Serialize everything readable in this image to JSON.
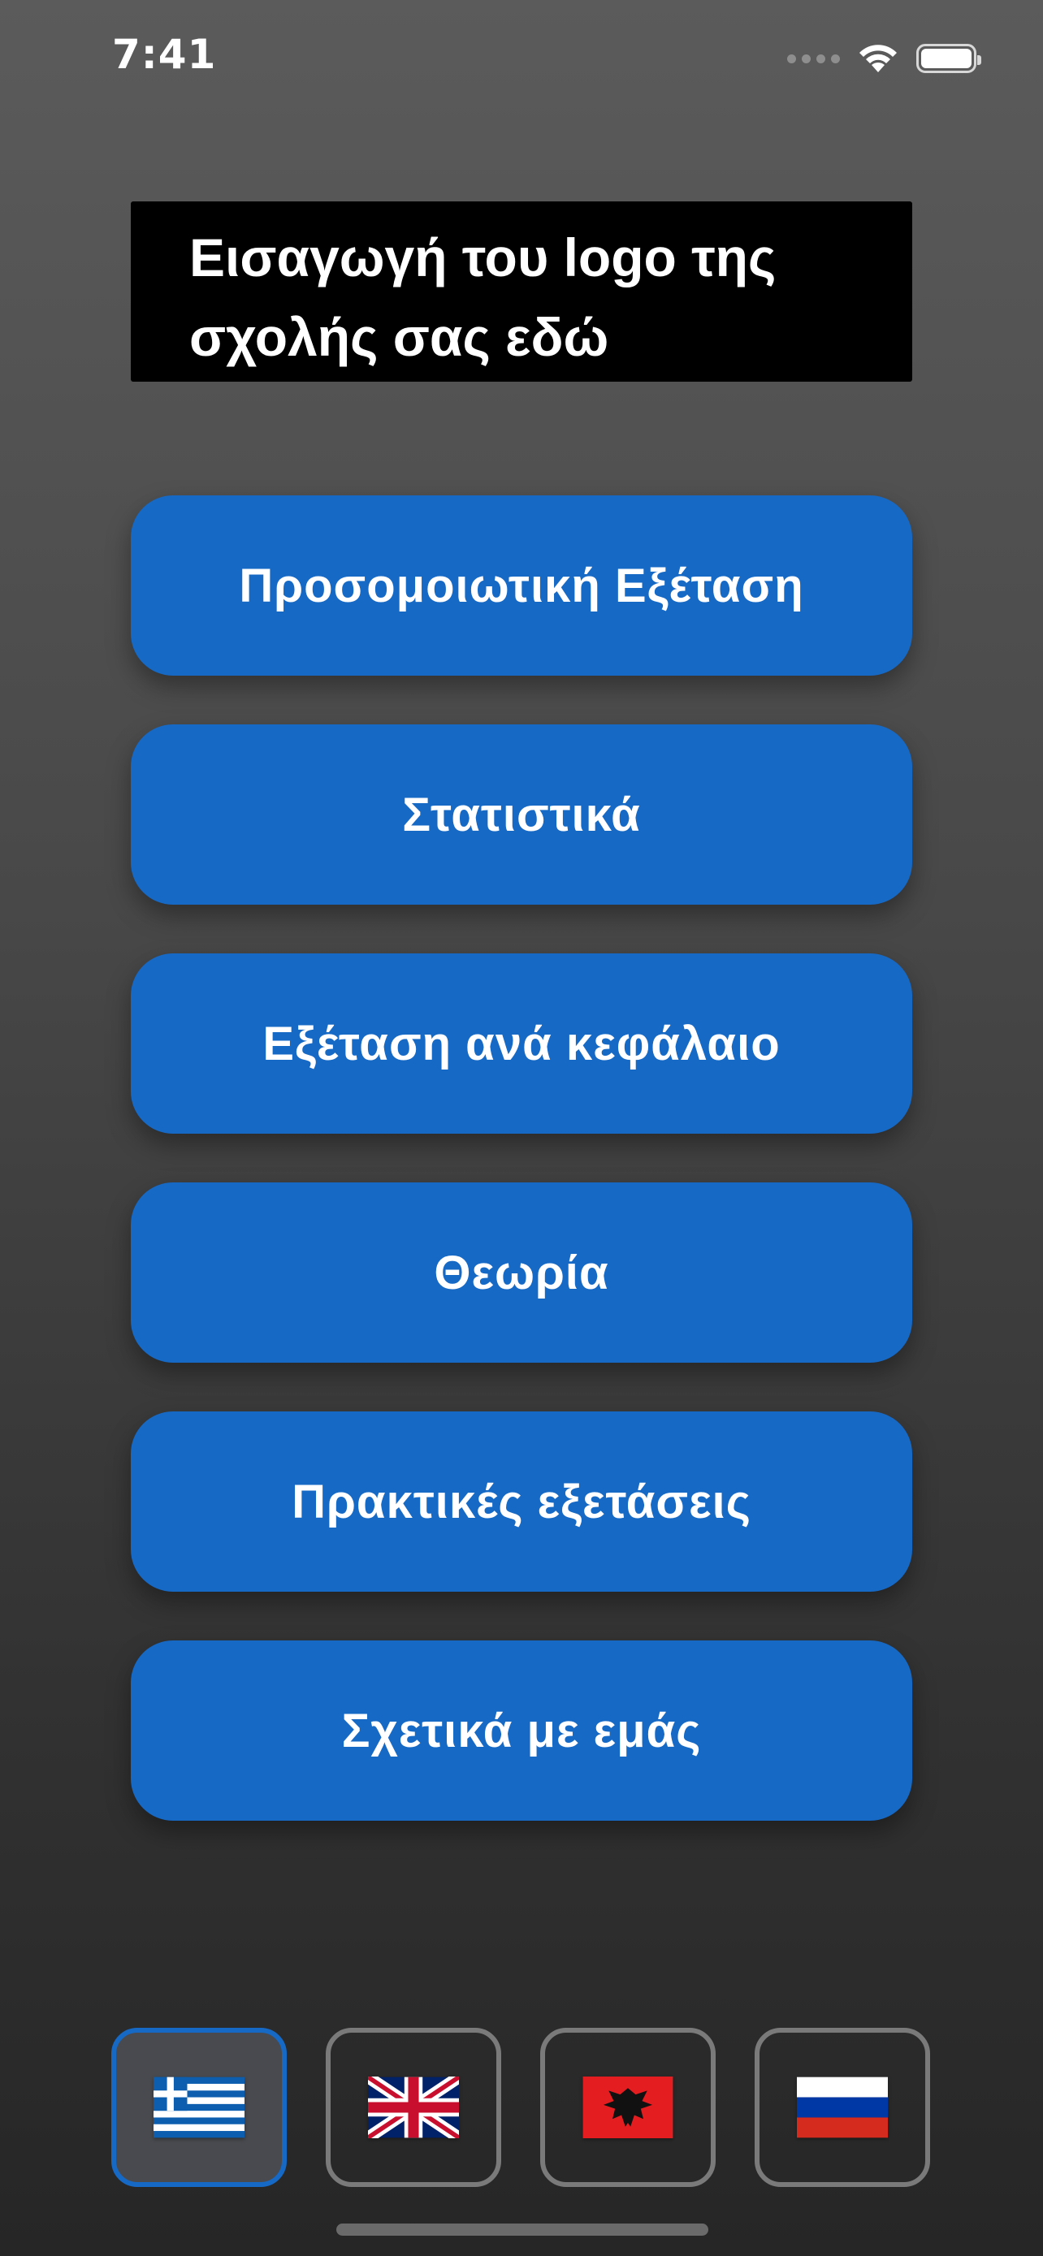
{
  "status_bar": {
    "time": "7:41",
    "icons": [
      "signal-icon",
      "wifi-icon",
      "battery-icon"
    ]
  },
  "logo_placeholder": {
    "line1": "Εισαγωγή του logo της",
    "line2": "σχολής σας εδώ"
  },
  "menu": {
    "items": [
      {
        "label": "Προσομοιωτική Εξέταση"
      },
      {
        "label": "Στατιστικά"
      },
      {
        "label": "Εξέταση ανά κεφάλαιο"
      },
      {
        "label": "Θεωρία"
      },
      {
        "label": "Πρακτικές εξετάσεις"
      },
      {
        "label": "Σχετικά με εμάς"
      }
    ]
  },
  "languages": {
    "selected": "greek",
    "options": [
      {
        "id": "greek",
        "icon": "greek-flag-icon"
      },
      {
        "id": "english",
        "icon": "uk-flag-icon"
      },
      {
        "id": "albanian",
        "icon": "albania-flag-icon"
      },
      {
        "id": "russian",
        "icon": "russia-flag-icon"
      }
    ]
  },
  "colors": {
    "button_blue": "#1769c6",
    "logo_background": "#000000",
    "selected_language_border": "#1769c6"
  }
}
